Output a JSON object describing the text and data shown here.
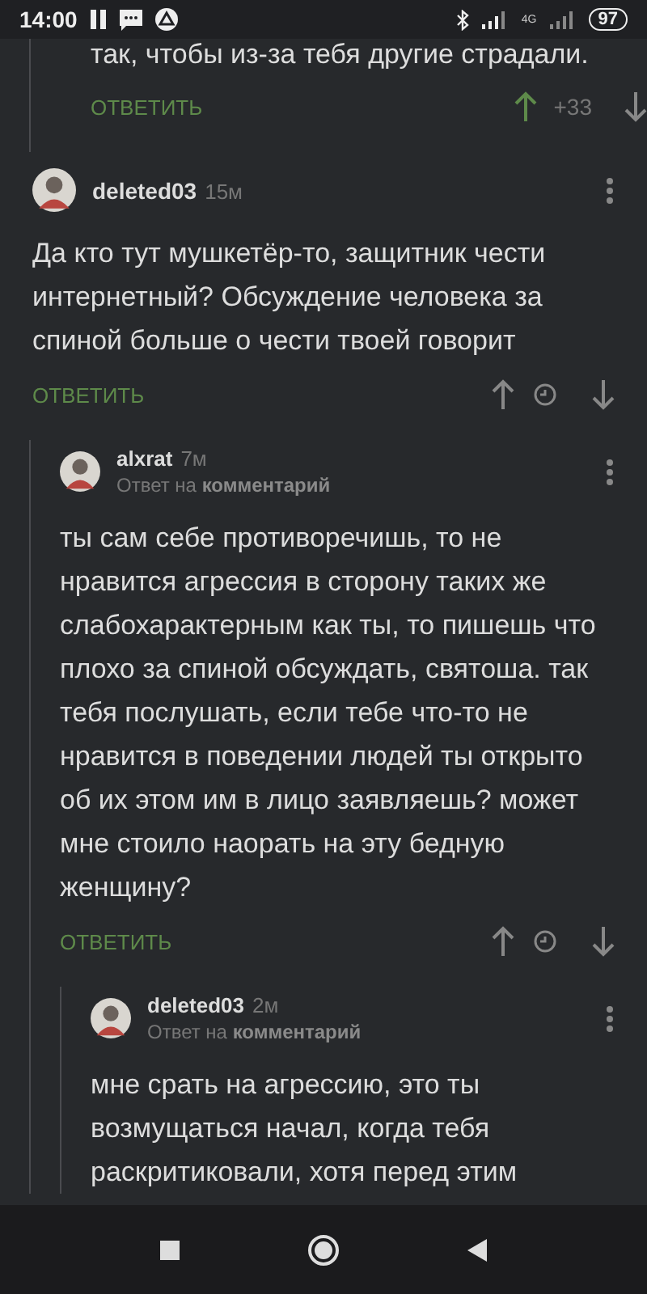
{
  "status_bar": {
    "time": "14:00",
    "network": "4G",
    "battery": "97"
  },
  "partial_comment": {
    "text": "так, чтобы из-за тебя другие страдали.",
    "reply": "ОТВЕТИТЬ",
    "vote": {
      "upvoted": true,
      "score": "+33"
    }
  },
  "comments": [
    {
      "author": "deleted03",
      "time": "15м",
      "text": "Да кто тут мушкетёр-то, защитник чести интернетный? Обсуждение человека за спиной больше о чести твоей говорит",
      "reply": "ОТВЕТИТЬ",
      "vote": {
        "upvoted": false
      },
      "children": [
        {
          "author": "alxrat",
          "time": "7м",
          "reply_to": "Ответ на **комментарий**",
          "text": "ты сам себе противоречишь, то не нравится агрессия в сторону таких же слабохарактерным как ты, то пишешь что плохо за спиной обсуждать, святоша. так тебя послушать, если тебе что-то не нравится в поведении людей ты открыто об их этом им в лицо заявляешь? может мне стоило наорать на эту бедную женщину?",
          "reply": "ОТВЕТИТЬ",
          "vote": {
            "upvoted": false
          },
          "children": [
            {
              "author": "deleted03",
              "time": "2м",
              "reply_to": "Ответ на **комментарий**",
              "text": "мне срать на агрессию, это ты возмущаться начал, когда тебя раскритиковали, хотя перед этим"
            }
          ]
        }
      ]
    }
  ]
}
